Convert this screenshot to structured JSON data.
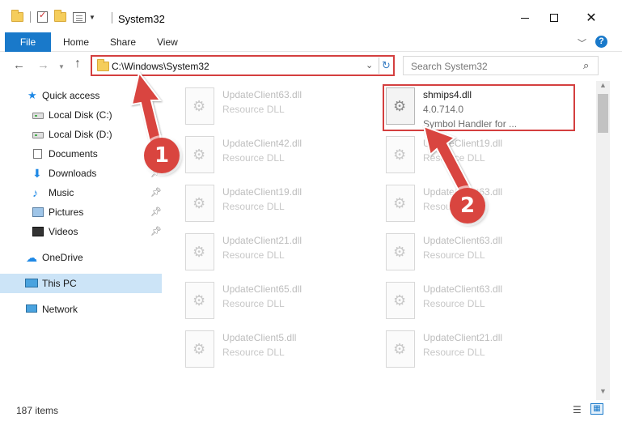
{
  "window": {
    "title": "System32",
    "close_label": "✕"
  },
  "ribbon": {
    "tabs": [
      "File",
      "Home",
      "Share",
      "View"
    ],
    "expand_icon": "chevron-down-icon",
    "help_label": "?"
  },
  "navigation": {
    "address": "C:\\Windows\\System32",
    "search_placeholder": "Search System32"
  },
  "sidebar": {
    "items": [
      {
        "label": "Quick access",
        "icon": "star-icon"
      },
      {
        "label": "Local Disk (C:)",
        "icon": "disk-icon"
      },
      {
        "label": "Local Disk (D:)",
        "icon": "disk-icon"
      },
      {
        "label": "Documents",
        "icon": "documents-icon"
      },
      {
        "label": "Downloads",
        "icon": "downloads-icon"
      },
      {
        "label": "Music",
        "icon": "music-icon"
      },
      {
        "label": "Pictures",
        "icon": "pictures-icon"
      },
      {
        "label": "Videos",
        "icon": "videos-icon"
      },
      {
        "label": "OneDrive",
        "icon": "onedrive-icon"
      },
      {
        "label": "This PC",
        "icon": "pc-icon"
      },
      {
        "label": "Network",
        "icon": "network-icon"
      }
    ],
    "selected": "This PC"
  },
  "files": {
    "highlighted": {
      "name": "shmips4.dll",
      "version": "4.0.714.0",
      "description": "Symbol Handler for ..."
    },
    "left_column": [
      {
        "name": "UpdateClient63.dll",
        "type": "Resource DLL"
      },
      {
        "name": "UpdateClient42.dll",
        "type": "Resource DLL"
      },
      {
        "name": "UpdateClient19.dll",
        "type": "Resource DLL"
      },
      {
        "name": "UpdateClient21.dll",
        "type": "Resource DLL"
      },
      {
        "name": "UpdateClient65.dll",
        "type": "Resource DLL"
      },
      {
        "name": "UpdateClient5.dll",
        "type": "Resource DLL"
      }
    ],
    "right_column": [
      {
        "name": "UpdateClient19.dll",
        "type": "Resource DLL"
      },
      {
        "name": "UpdateClient63.dll",
        "type": "Resource DLL"
      },
      {
        "name": "UpdateClient63.dll",
        "type": "Resource DLL"
      },
      {
        "name": "UpdateClient63.dll",
        "type": "Resource DLL"
      },
      {
        "name": "UpdateClient21.dll",
        "type": "Resource DLL"
      }
    ]
  },
  "status": {
    "item_count": "187 items"
  },
  "callouts": {
    "step1": "1",
    "step2": "2",
    "highlight_color": "#d43f3f"
  }
}
